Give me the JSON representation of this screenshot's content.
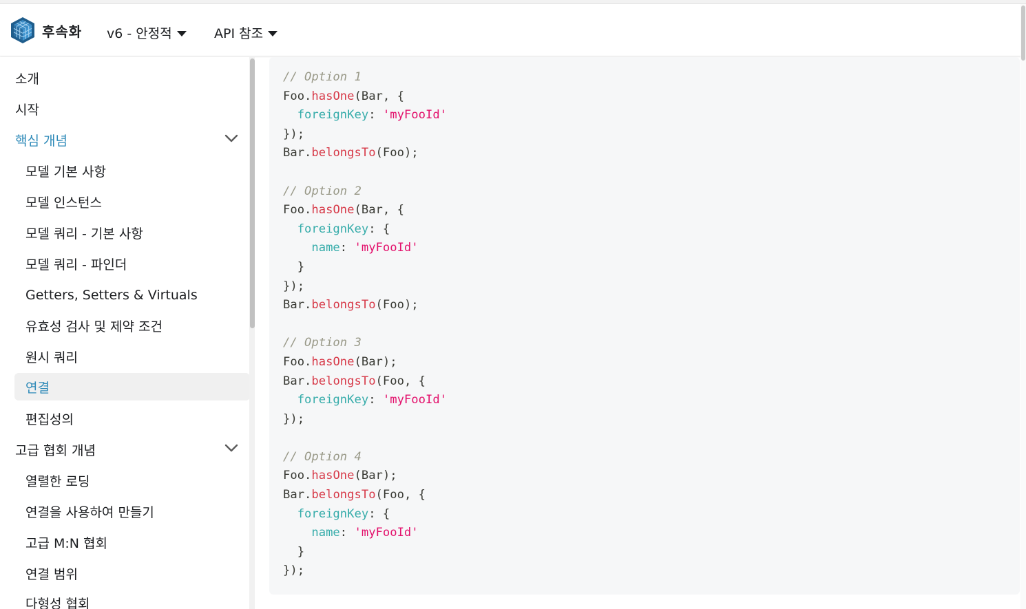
{
  "navbar": {
    "brand_title": "후속화",
    "logo_icon": "sequelize-cube-logo",
    "version_label": "v6 - 안정적",
    "api_label": "API 참조"
  },
  "sidebar": {
    "items": [
      {
        "label": "소개",
        "level": 1
      },
      {
        "label": "시작",
        "level": 1
      },
      {
        "label": "핵심 개념",
        "level": 1,
        "expanded": true,
        "active_category": true
      },
      {
        "label": "모델 기본 사항",
        "level": 2
      },
      {
        "label": "모델 인스턴스",
        "level": 2
      },
      {
        "label": "모델 쿼리 - 기본 사항",
        "level": 2
      },
      {
        "label": "모델 쿼리 - 파인더",
        "level": 2
      },
      {
        "label": "Getters, Setters & Virtuals",
        "level": 2
      },
      {
        "label": "유효성 검사 및 제약 조건",
        "level": 2
      },
      {
        "label": "원시 쿼리",
        "level": 2
      },
      {
        "label": "연결",
        "level": 2,
        "active": true
      },
      {
        "label": "편집성의",
        "level": 2
      },
      {
        "label": "고급 협회 개념",
        "level": 1,
        "expanded": true
      },
      {
        "label": "열렬한 로딩",
        "level": 2
      },
      {
        "label": "연결을 사용하여 만들기",
        "level": 2
      },
      {
        "label": "고급 M:N 협회",
        "level": 2
      },
      {
        "label": "연결 범위",
        "level": 2
      },
      {
        "label": "다형성 협회",
        "level": 2
      }
    ]
  },
  "code": {
    "lines": [
      [
        {
          "t": "// Option 1",
          "c": "comment"
        }
      ],
      [
        {
          "t": "Foo.",
          "c": "plain"
        },
        {
          "t": "hasOne",
          "c": "fn"
        },
        {
          "t": "(Bar, {",
          "c": "plain"
        }
      ],
      [
        {
          "t": "  foreignKey",
          "c": "prop"
        },
        {
          "t": ": ",
          "c": "plain"
        },
        {
          "t": "'myFooId'",
          "c": "str"
        }
      ],
      [
        {
          "t": "});",
          "c": "plain"
        }
      ],
      [
        {
          "t": "Bar.",
          "c": "plain"
        },
        {
          "t": "belongsTo",
          "c": "fn"
        },
        {
          "t": "(Foo);",
          "c": "plain"
        }
      ],
      [],
      [
        {
          "t": "// Option 2",
          "c": "comment"
        }
      ],
      [
        {
          "t": "Foo.",
          "c": "plain"
        },
        {
          "t": "hasOne",
          "c": "fn"
        },
        {
          "t": "(Bar, {",
          "c": "plain"
        }
      ],
      [
        {
          "t": "  foreignKey",
          "c": "prop"
        },
        {
          "t": ": {",
          "c": "plain"
        }
      ],
      [
        {
          "t": "    name",
          "c": "prop"
        },
        {
          "t": ": ",
          "c": "plain"
        },
        {
          "t": "'myFooId'",
          "c": "str"
        }
      ],
      [
        {
          "t": "  }",
          "c": "plain"
        }
      ],
      [
        {
          "t": "});",
          "c": "plain"
        }
      ],
      [
        {
          "t": "Bar.",
          "c": "plain"
        },
        {
          "t": "belongsTo",
          "c": "fn"
        },
        {
          "t": "(Foo);",
          "c": "plain"
        }
      ],
      [],
      [
        {
          "t": "// Option 3",
          "c": "comment"
        }
      ],
      [
        {
          "t": "Foo.",
          "c": "plain"
        },
        {
          "t": "hasOne",
          "c": "fn"
        },
        {
          "t": "(Bar);",
          "c": "plain"
        }
      ],
      [
        {
          "t": "Bar.",
          "c": "plain"
        },
        {
          "t": "belongsTo",
          "c": "fn"
        },
        {
          "t": "(Foo, {",
          "c": "plain"
        }
      ],
      [
        {
          "t": "  foreignKey",
          "c": "prop"
        },
        {
          "t": ": ",
          "c": "plain"
        },
        {
          "t": "'myFooId'",
          "c": "str"
        }
      ],
      [
        {
          "t": "});",
          "c": "plain"
        }
      ],
      [],
      [
        {
          "t": "// Option 4",
          "c": "comment"
        }
      ],
      [
        {
          "t": "Foo.",
          "c": "plain"
        },
        {
          "t": "hasOne",
          "c": "fn"
        },
        {
          "t": "(Bar);",
          "c": "plain"
        }
      ],
      [
        {
          "t": "Bar.",
          "c": "plain"
        },
        {
          "t": "belongsTo",
          "c": "fn"
        },
        {
          "t": "(Foo, {",
          "c": "plain"
        }
      ],
      [
        {
          "t": "  foreignKey",
          "c": "prop"
        },
        {
          "t": ": {",
          "c": "plain"
        }
      ],
      [
        {
          "t": "    name",
          "c": "prop"
        },
        {
          "t": ": ",
          "c": "plain"
        },
        {
          "t": "'myFooId'",
          "c": "str"
        }
      ],
      [
        {
          "t": "  }",
          "c": "plain"
        }
      ],
      [
        {
          "t": "});",
          "c": "plain"
        }
      ]
    ]
  },
  "colors": {
    "accent": "#2e8ab8",
    "active_bg": "#f0f0f0",
    "code_bg": "#f6f7f8"
  }
}
